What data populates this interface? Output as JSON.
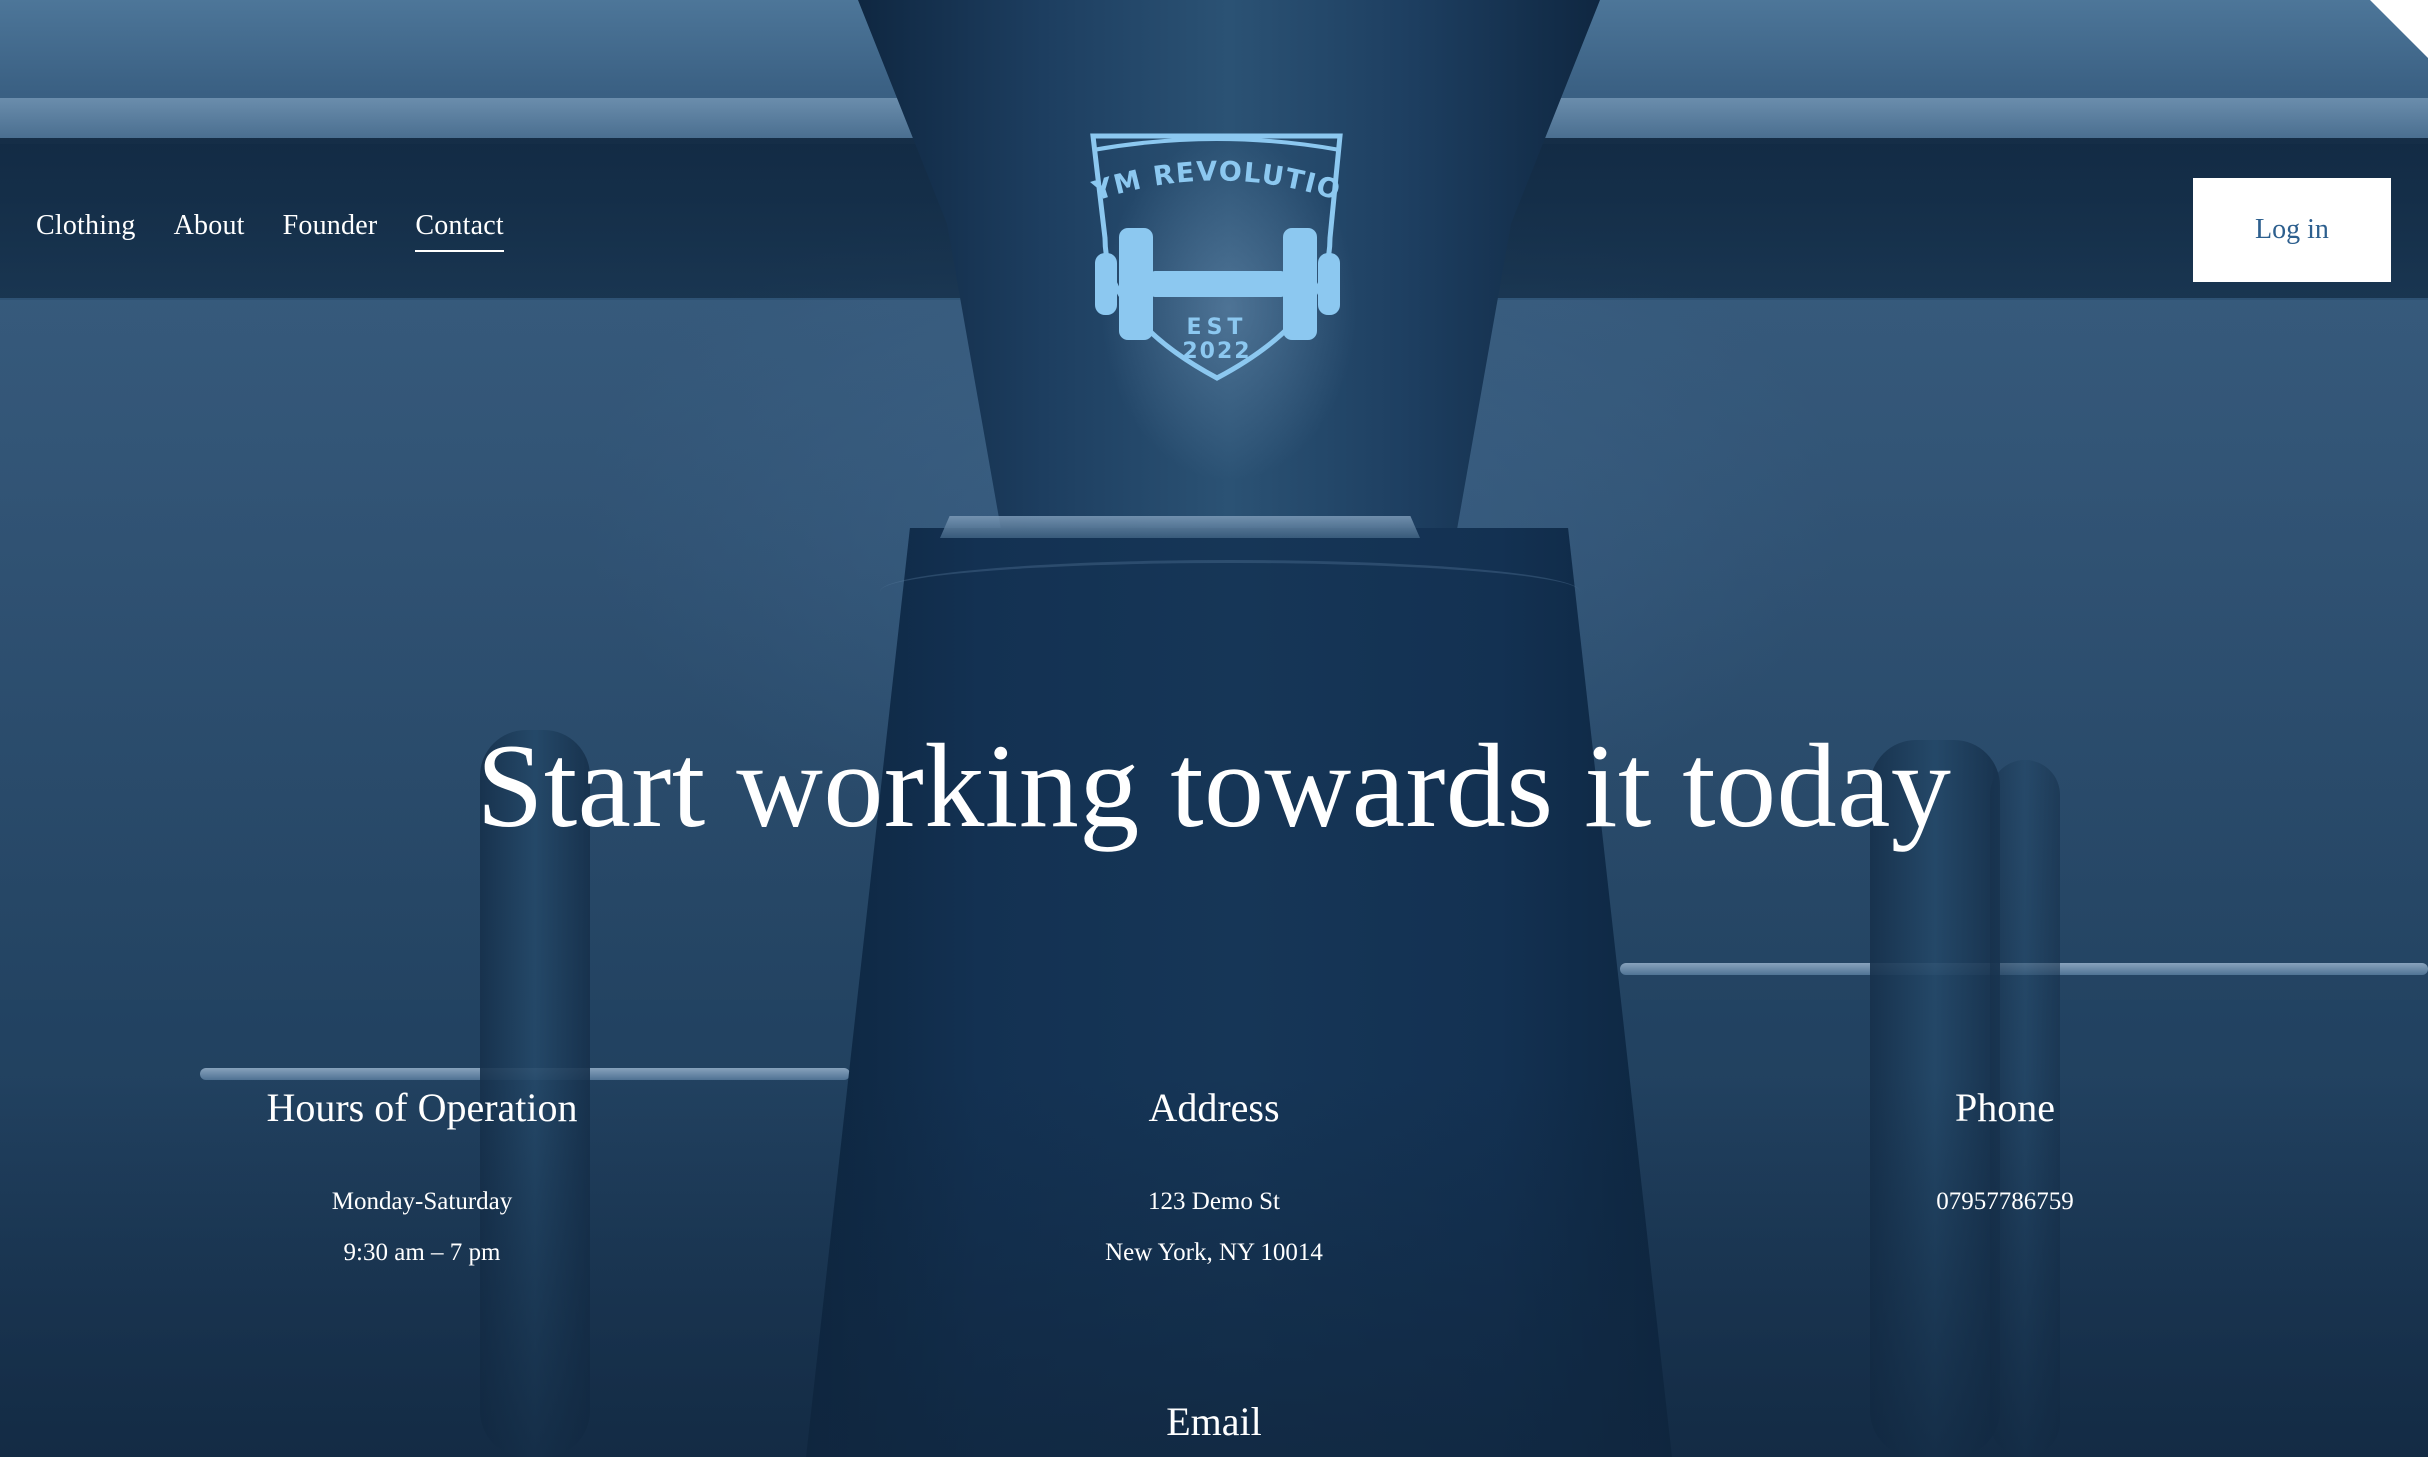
{
  "nav": {
    "items": [
      {
        "label": "Clothing"
      },
      {
        "label": "About"
      },
      {
        "label": "Founder"
      },
      {
        "label": "Contact",
        "active": true
      }
    ]
  },
  "logo": {
    "name": "GYM REVOLUTION",
    "est": "EST",
    "year": "2022",
    "icon": "dumbbell-shield-icon",
    "color": "#8cc8f0"
  },
  "login": {
    "label": "Log in",
    "text_color": "#2d5f8e",
    "background": "#ffffff"
  },
  "hero": {
    "title": "Start working towards it today"
  },
  "contact": {
    "hours": {
      "heading": "Hours of Operation",
      "line1": "Monday-Saturday",
      "line2": "9:30 am – 7 pm"
    },
    "address": {
      "heading": "Address",
      "line1": "123 Demo St",
      "line2": "New York, NY 10014"
    },
    "phone": {
      "heading": "Phone",
      "line1": "07957786759"
    },
    "email": {
      "heading": "Email"
    }
  },
  "theme": {
    "background": "#15324f",
    "text": "#ffffff"
  }
}
